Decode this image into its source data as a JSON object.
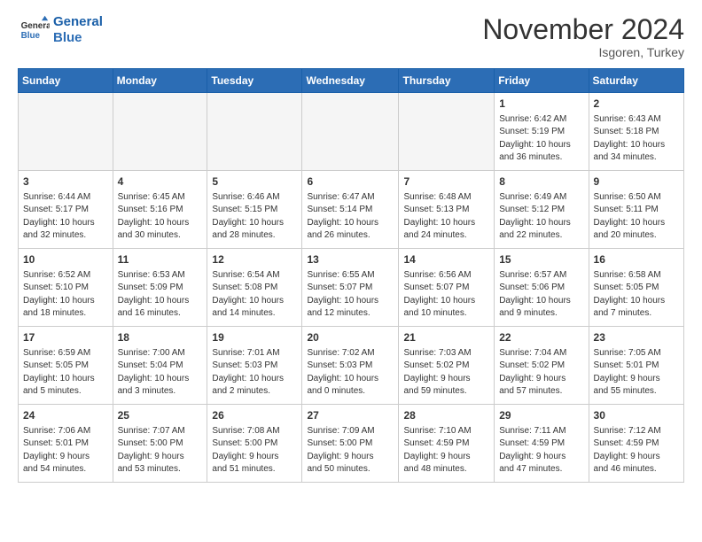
{
  "header": {
    "logo_line1": "General",
    "logo_line2": "Blue",
    "month": "November 2024",
    "location": "Isgoren, Turkey"
  },
  "weekdays": [
    "Sunday",
    "Monday",
    "Tuesday",
    "Wednesday",
    "Thursday",
    "Friday",
    "Saturday"
  ],
  "weeks": [
    [
      {
        "day": "",
        "info": ""
      },
      {
        "day": "",
        "info": ""
      },
      {
        "day": "",
        "info": ""
      },
      {
        "day": "",
        "info": ""
      },
      {
        "day": "",
        "info": ""
      },
      {
        "day": "1",
        "info": "Sunrise: 6:42 AM\nSunset: 5:19 PM\nDaylight: 10 hours\nand 36 minutes."
      },
      {
        "day": "2",
        "info": "Sunrise: 6:43 AM\nSunset: 5:18 PM\nDaylight: 10 hours\nand 34 minutes."
      }
    ],
    [
      {
        "day": "3",
        "info": "Sunrise: 6:44 AM\nSunset: 5:17 PM\nDaylight: 10 hours\nand 32 minutes."
      },
      {
        "day": "4",
        "info": "Sunrise: 6:45 AM\nSunset: 5:16 PM\nDaylight: 10 hours\nand 30 minutes."
      },
      {
        "day": "5",
        "info": "Sunrise: 6:46 AM\nSunset: 5:15 PM\nDaylight: 10 hours\nand 28 minutes."
      },
      {
        "day": "6",
        "info": "Sunrise: 6:47 AM\nSunset: 5:14 PM\nDaylight: 10 hours\nand 26 minutes."
      },
      {
        "day": "7",
        "info": "Sunrise: 6:48 AM\nSunset: 5:13 PM\nDaylight: 10 hours\nand 24 minutes."
      },
      {
        "day": "8",
        "info": "Sunrise: 6:49 AM\nSunset: 5:12 PM\nDaylight: 10 hours\nand 22 minutes."
      },
      {
        "day": "9",
        "info": "Sunrise: 6:50 AM\nSunset: 5:11 PM\nDaylight: 10 hours\nand 20 minutes."
      }
    ],
    [
      {
        "day": "10",
        "info": "Sunrise: 6:52 AM\nSunset: 5:10 PM\nDaylight: 10 hours\nand 18 minutes."
      },
      {
        "day": "11",
        "info": "Sunrise: 6:53 AM\nSunset: 5:09 PM\nDaylight: 10 hours\nand 16 minutes."
      },
      {
        "day": "12",
        "info": "Sunrise: 6:54 AM\nSunset: 5:08 PM\nDaylight: 10 hours\nand 14 minutes."
      },
      {
        "day": "13",
        "info": "Sunrise: 6:55 AM\nSunset: 5:07 PM\nDaylight: 10 hours\nand 12 minutes."
      },
      {
        "day": "14",
        "info": "Sunrise: 6:56 AM\nSunset: 5:07 PM\nDaylight: 10 hours\nand 10 minutes."
      },
      {
        "day": "15",
        "info": "Sunrise: 6:57 AM\nSunset: 5:06 PM\nDaylight: 10 hours\nand 9 minutes."
      },
      {
        "day": "16",
        "info": "Sunrise: 6:58 AM\nSunset: 5:05 PM\nDaylight: 10 hours\nand 7 minutes."
      }
    ],
    [
      {
        "day": "17",
        "info": "Sunrise: 6:59 AM\nSunset: 5:05 PM\nDaylight: 10 hours\nand 5 minutes."
      },
      {
        "day": "18",
        "info": "Sunrise: 7:00 AM\nSunset: 5:04 PM\nDaylight: 10 hours\nand 3 minutes."
      },
      {
        "day": "19",
        "info": "Sunrise: 7:01 AM\nSunset: 5:03 PM\nDaylight: 10 hours\nand 2 minutes."
      },
      {
        "day": "20",
        "info": "Sunrise: 7:02 AM\nSunset: 5:03 PM\nDaylight: 10 hours\nand 0 minutes."
      },
      {
        "day": "21",
        "info": "Sunrise: 7:03 AM\nSunset: 5:02 PM\nDaylight: 9 hours\nand 59 minutes."
      },
      {
        "day": "22",
        "info": "Sunrise: 7:04 AM\nSunset: 5:02 PM\nDaylight: 9 hours\nand 57 minutes."
      },
      {
        "day": "23",
        "info": "Sunrise: 7:05 AM\nSunset: 5:01 PM\nDaylight: 9 hours\nand 55 minutes."
      }
    ],
    [
      {
        "day": "24",
        "info": "Sunrise: 7:06 AM\nSunset: 5:01 PM\nDaylight: 9 hours\nand 54 minutes."
      },
      {
        "day": "25",
        "info": "Sunrise: 7:07 AM\nSunset: 5:00 PM\nDaylight: 9 hours\nand 53 minutes."
      },
      {
        "day": "26",
        "info": "Sunrise: 7:08 AM\nSunset: 5:00 PM\nDaylight: 9 hours\nand 51 minutes."
      },
      {
        "day": "27",
        "info": "Sunrise: 7:09 AM\nSunset: 5:00 PM\nDaylight: 9 hours\nand 50 minutes."
      },
      {
        "day": "28",
        "info": "Sunrise: 7:10 AM\nSunset: 4:59 PM\nDaylight: 9 hours\nand 48 minutes."
      },
      {
        "day": "29",
        "info": "Sunrise: 7:11 AM\nSunset: 4:59 PM\nDaylight: 9 hours\nand 47 minutes."
      },
      {
        "day": "30",
        "info": "Sunrise: 7:12 AM\nSunset: 4:59 PM\nDaylight: 9 hours\nand 46 minutes."
      }
    ]
  ]
}
